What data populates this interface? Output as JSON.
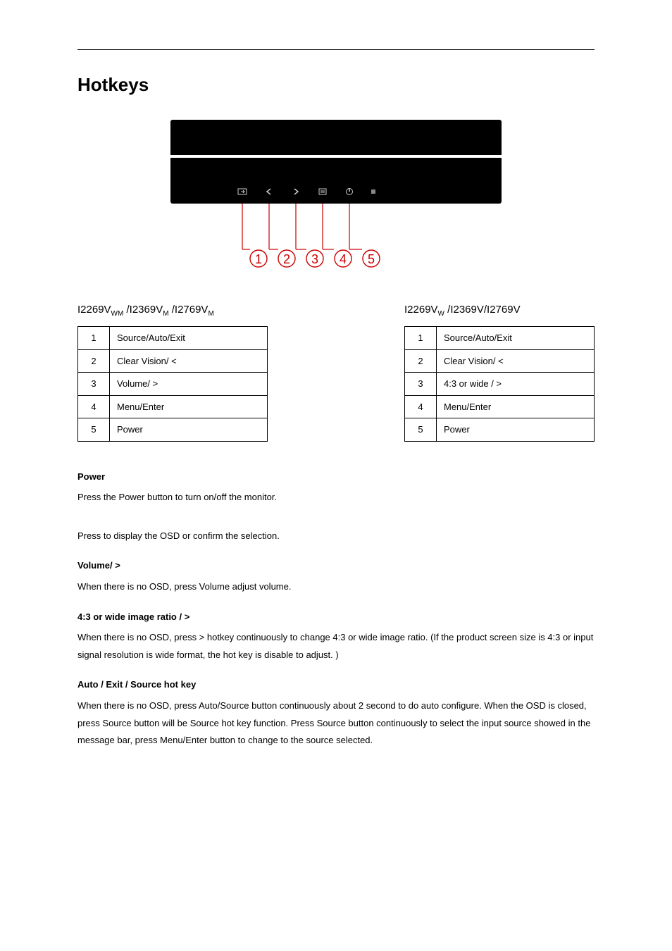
{
  "title": "Hotkeys",
  "models_left_html": "I2269V<span class='sub'>WM</span> /I2369V<span class='sub'>M</span> /I2769V<span class='sub'>M</span>",
  "models_right_html": "I2269V<span class='sub'>W</span> /I2369V/I2769V",
  "table_left": [
    {
      "n": "1",
      "label": "Source/Auto/Exit"
    },
    {
      "n": "2",
      "label": "Clear Vision/ <"
    },
    {
      "n": "3",
      "label": "Volume/ >"
    },
    {
      "n": "4",
      "label": "Menu/Enter"
    },
    {
      "n": "5",
      "label": "Power"
    }
  ],
  "table_right": [
    {
      "n": "1",
      "label": "Source/Auto/Exit"
    },
    {
      "n": "2",
      "label": "Clear Vision/ <"
    },
    {
      "n": "3",
      "label": "4:3 or wide / >"
    },
    {
      "n": "4",
      "label": "Menu/Enter"
    },
    {
      "n": "5",
      "label": "Power"
    }
  ],
  "sections": {
    "power_title": "Power",
    "power_text": "Press the Power button to turn on/off the monitor.",
    "menu_text": "Press to display the OSD or confirm the selection.",
    "volume_title": "Volume/ >",
    "volume_text": "When there is no OSD, press Volume adjust volume.",
    "ratio_title": "4:3 or wide image ratio / >",
    "ratio_text": "When there is no OSD, press  >  hotkey continuously to change 4:3 or wide image ratio. (If the product screen size is 4:3 or input signal resolution is wide format, the hot key is disable to adjust. )",
    "auto_title": "Auto / Exit / Source hot key",
    "auto_text": "When there is no OSD, press Auto/Source button continuously about 2 second to do auto configure. When the OSD is closed, press Source button will be Source hot key function. Press Source button continuously to select the input source showed in the message bar, press Menu/Enter button to change to the source selected."
  }
}
